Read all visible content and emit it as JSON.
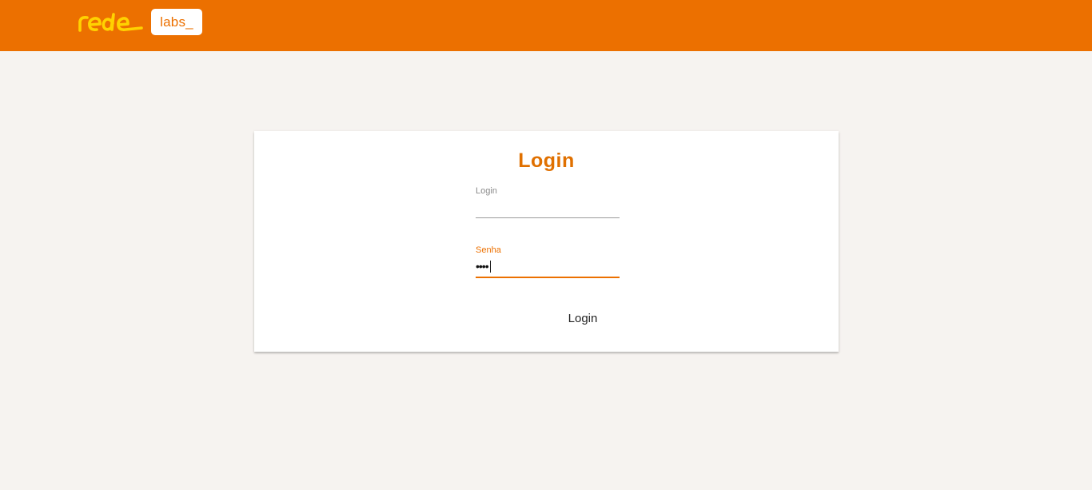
{
  "header": {
    "brand_logo_text": "rede",
    "labs_badge": "labs_",
    "background_color": "#ec7000"
  },
  "login_card": {
    "title": "Login",
    "login_field": {
      "label": "Login",
      "value": ""
    },
    "password_field": {
      "label": "Senha",
      "masked_value": "••••"
    },
    "submit_label": "Login"
  },
  "colors": {
    "accent": "#ec7000",
    "logo_yellow": "#ffd200",
    "page_background": "#f6f3f0"
  }
}
